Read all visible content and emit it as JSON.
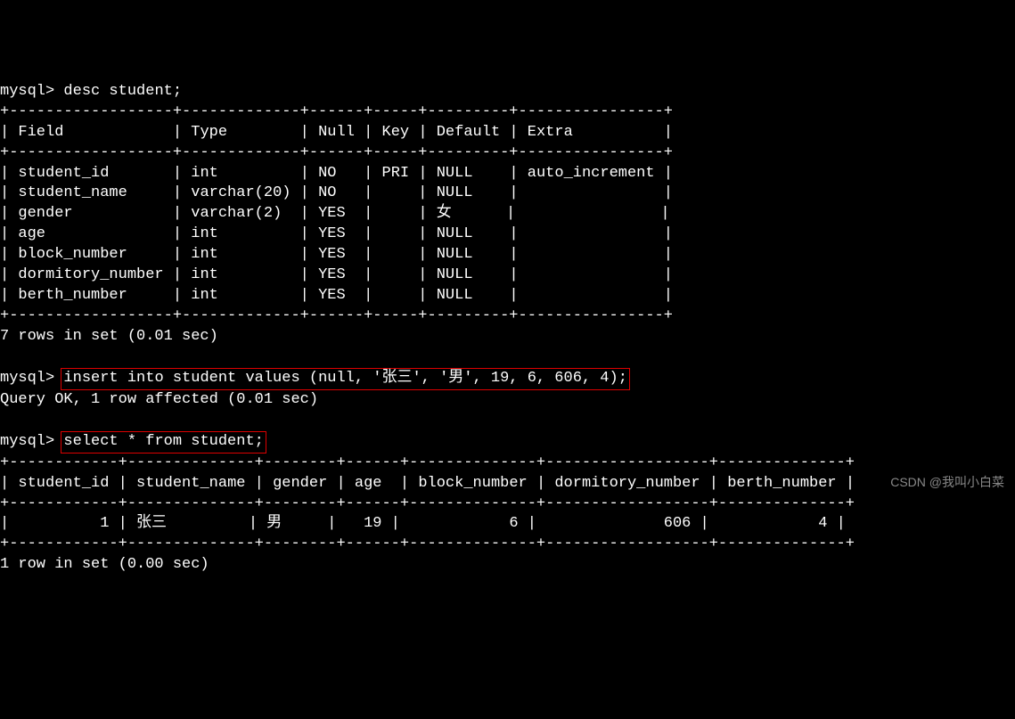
{
  "prompt": "mysql>",
  "commands": {
    "desc": "desc student;",
    "insert": "insert into student values (null, '张三', '男', 19, 6, 606, 4);",
    "select": "select * from student;"
  },
  "desc_table": {
    "headers": [
      "Field",
      "Type",
      "Null",
      "Key",
      "Default",
      "Extra"
    ],
    "rows": [
      {
        "field": "student_id",
        "type": "int",
        "null": "NO",
        "key": "PRI",
        "default": "NULL",
        "extra": "auto_increment"
      },
      {
        "field": "student_name",
        "type": "varchar(20)",
        "null": "NO",
        "key": "",
        "default": "NULL",
        "extra": ""
      },
      {
        "field": "gender",
        "type": "varchar(2)",
        "null": "YES",
        "key": "",
        "default": "女",
        "extra": ""
      },
      {
        "field": "age",
        "type": "int",
        "null": "YES",
        "key": "",
        "default": "NULL",
        "extra": ""
      },
      {
        "field": "block_number",
        "type": "int",
        "null": "YES",
        "key": "",
        "default": "NULL",
        "extra": ""
      },
      {
        "field": "dormitory_number",
        "type": "int",
        "null": "YES",
        "key": "",
        "default": "NULL",
        "extra": ""
      },
      {
        "field": "berth_number",
        "type": "int",
        "null": "YES",
        "key": "",
        "default": "NULL",
        "extra": ""
      }
    ],
    "footer": "7 rows in set (0.01 sec)"
  },
  "insert_result": "Query OK, 1 row affected (0.01 sec)",
  "select_table": {
    "headers": [
      "student_id",
      "student_name",
      "gender",
      "age",
      "block_number",
      "dormitory_number",
      "berth_number"
    ],
    "rows": [
      {
        "student_id": "1",
        "student_name": "张三",
        "gender": "男",
        "age": "19",
        "block_number": "6",
        "dormitory_number": "606",
        "berth_number": "4"
      }
    ],
    "footer": "1 row in set (0.00 sec)"
  },
  "watermark": "CSDN @我叫小白菜"
}
